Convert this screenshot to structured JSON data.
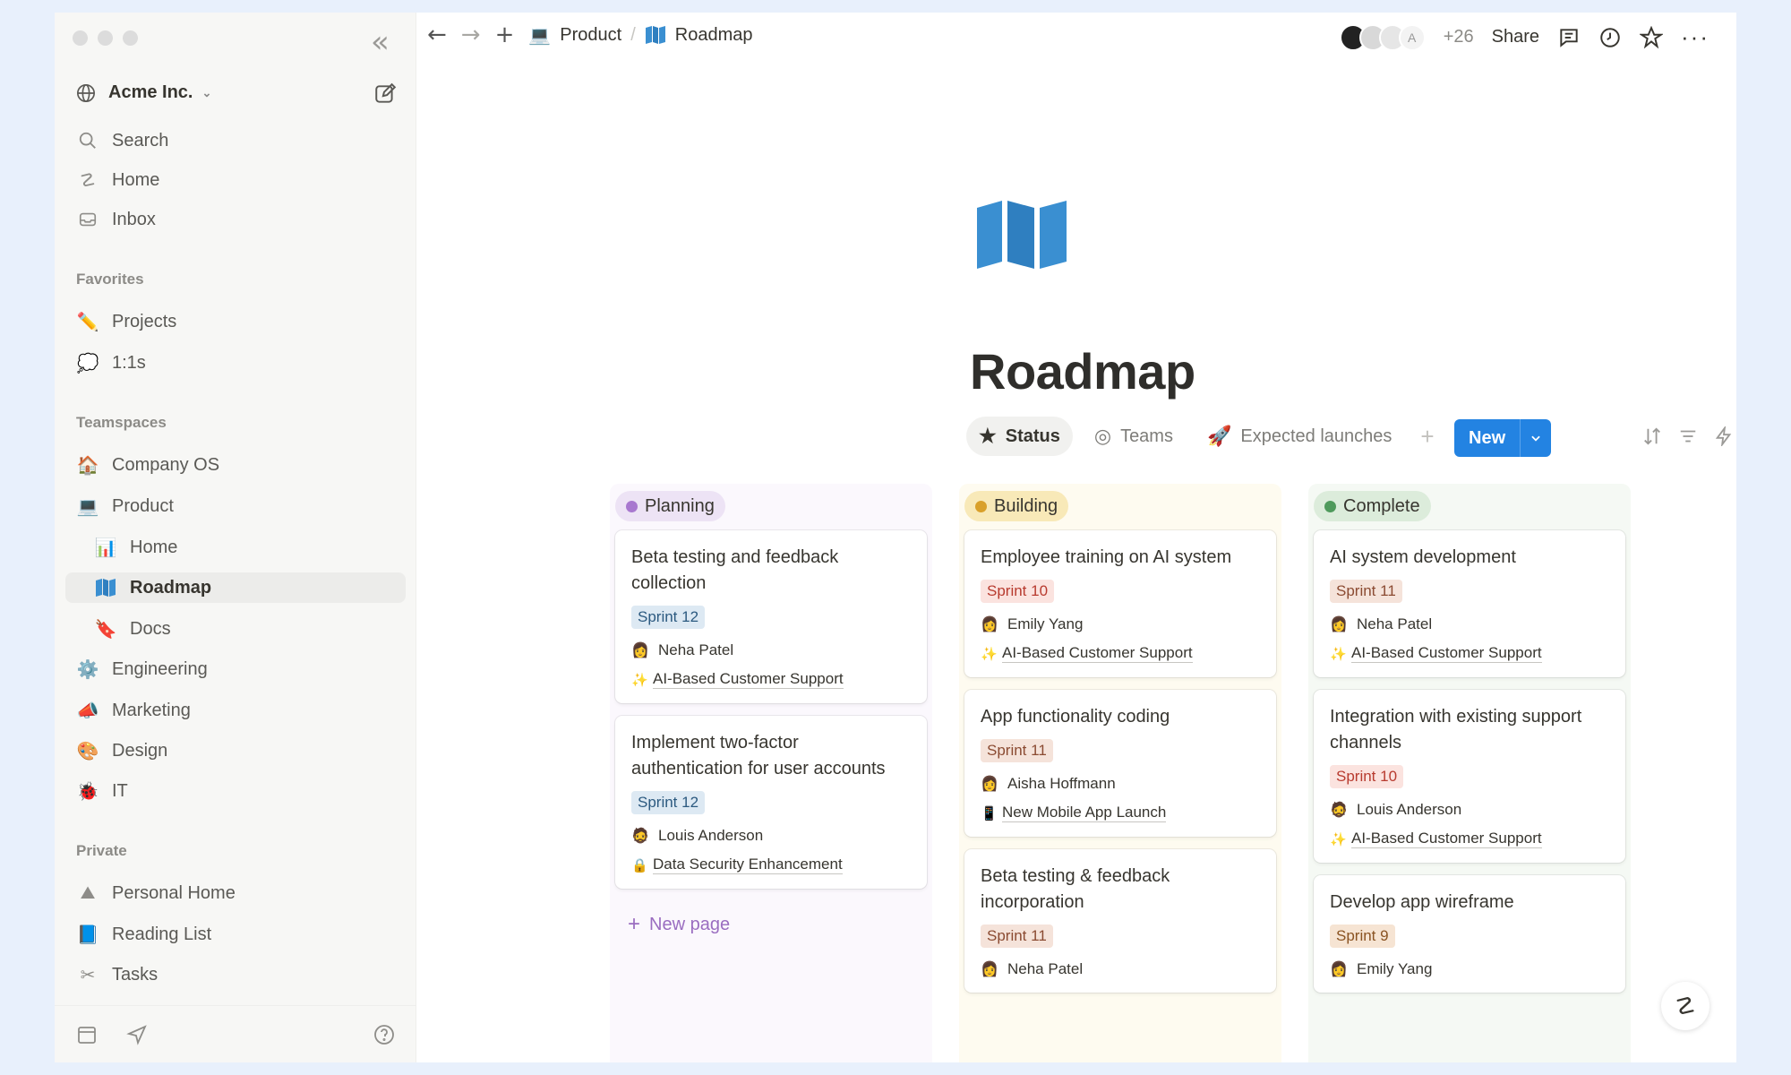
{
  "sidebar": {
    "workspace": "Acme Inc.",
    "nav": [
      {
        "label": "Search",
        "icon": "search-icon"
      },
      {
        "label": "Home",
        "icon": "home-icon"
      },
      {
        "label": "Inbox",
        "icon": "inbox-icon"
      }
    ],
    "favorites_label": "Favorites",
    "favorites": [
      {
        "label": "Projects",
        "icon": "✏️"
      },
      {
        "label": "1:1s",
        "icon": "💭"
      }
    ],
    "teamspaces_label": "Teamspaces",
    "teamspaces": [
      {
        "label": "Company OS",
        "icon": "🏠"
      },
      {
        "label": "Product",
        "icon": "💻"
      },
      {
        "label": "Home",
        "icon": "📊"
      },
      {
        "label": "Roadmap",
        "icon": "🗺"
      },
      {
        "label": "Docs",
        "icon": "🔖"
      },
      {
        "label": "Engineering",
        "icon": "⚙️"
      },
      {
        "label": "Marketing",
        "icon": "📣"
      },
      {
        "label": "Design",
        "icon": "🎨"
      },
      {
        "label": "IT",
        "icon": "🐞"
      }
    ],
    "private_label": "Private",
    "private": [
      {
        "label": "Personal Home",
        "icon": "⛰"
      },
      {
        "label": "Reading List",
        "icon": "📘"
      },
      {
        "label": "Tasks",
        "icon": "✂"
      }
    ]
  },
  "topbar": {
    "breadcrumb": [
      "Product",
      "Roadmap"
    ],
    "avatar_letter": "A",
    "avatar_count": "+26",
    "share_label": "Share"
  },
  "page": {
    "title": "Roadmap",
    "views": [
      {
        "label": "Status",
        "icon": "★"
      },
      {
        "label": "Teams",
        "icon": "◎"
      },
      {
        "label": "Expected launches",
        "icon": "🚀"
      }
    ],
    "new_button": "New"
  },
  "board": {
    "columns": [
      {
        "name": "Planning",
        "cards": [
          {
            "title": "Beta testing and feedback collection",
            "sprint": "Sprint 12",
            "person": "Neha Patel",
            "project": "AI-Based Customer Support"
          },
          {
            "title": "Implement two-factor authentication for user accounts",
            "sprint": "Sprint 12",
            "person": "Louis Anderson",
            "project": "Data Security Enhancement"
          }
        ],
        "new_page": "New page"
      },
      {
        "name": "Building",
        "cards": [
          {
            "title": "Employee training on AI system",
            "sprint": "Sprint 10",
            "person": "Emily Yang",
            "project": "AI-Based Customer Support"
          },
          {
            "title": "App functionality coding",
            "sprint": "Sprint 11",
            "person": "Aisha Hoffmann",
            "project": "New Mobile App Launch"
          },
          {
            "title": "Beta testing & feedback incorporation",
            "sprint": "Sprint 11",
            "person": "Neha Patel",
            "project": ""
          }
        ]
      },
      {
        "name": "Complete",
        "cards": [
          {
            "title": "AI system development",
            "sprint": "Sprint 11",
            "person": "Neha Patel",
            "project": "AI-Based Customer Support"
          },
          {
            "title": "Integration with existing support channels",
            "sprint": "Sprint 10",
            "person": "Louis Anderson",
            "project": "AI-Based Customer Support"
          },
          {
            "title": "Develop app wireframe",
            "sprint": "Sprint 9",
            "person": "Emily Yang",
            "project": ""
          }
        ]
      }
    ]
  },
  "colors": {
    "accent": "#2383e2",
    "planning": "#a878cf",
    "building": "#d9a02a",
    "complete": "#4f9a5c"
  }
}
